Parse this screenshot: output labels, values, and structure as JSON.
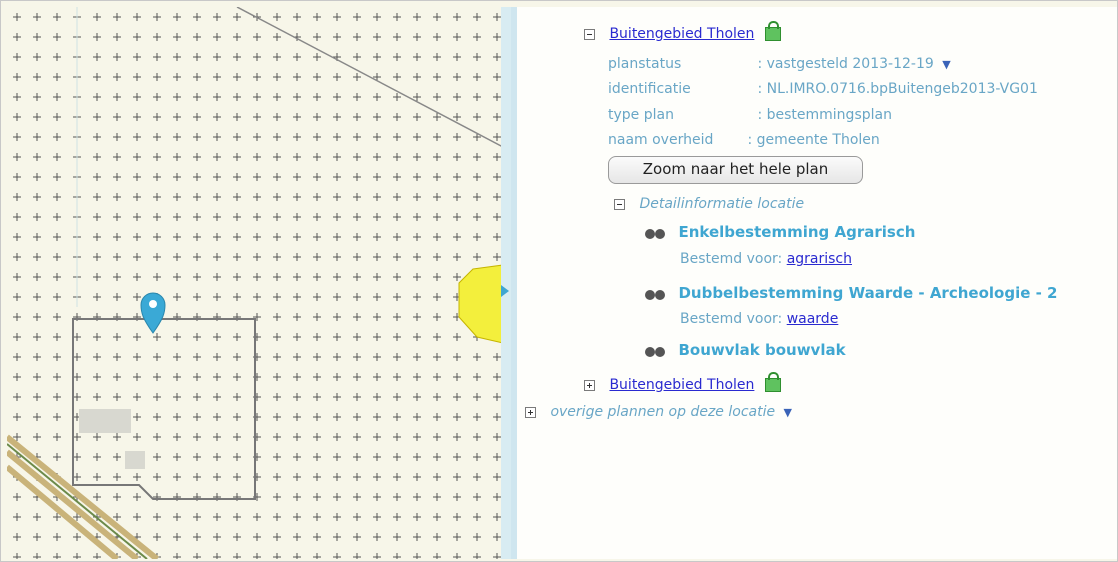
{
  "plan": {
    "title": "Buitengebied Tholen",
    "fields": [
      {
        "label": "planstatus",
        "value": ": vastgesteld 2013-12-19"
      },
      {
        "label": "identificatie",
        "value": ": NL.IMRO.0716.bpBuitengeb2013-VG01"
      },
      {
        "label": "type plan",
        "value": ": bestemmingsplan"
      },
      {
        "label": "naam overheid",
        "value": ": gemeente Tholen"
      }
    ],
    "zoom_button": "Zoom naar het hele plan",
    "detail_header": "Detailinformatie locatie",
    "bestemmingen": [
      {
        "name": "Enkelbestemming Agrarisch",
        "prefix": "Bestemd voor:",
        "link": "agrarisch"
      },
      {
        "name": "Dubbelbestemming Waarde - Archeologie - 2",
        "prefix": "Bestemd voor:",
        "link": "waarde"
      },
      {
        "name": "Bouwvlak bouwvlak"
      }
    ]
  },
  "plan2": {
    "title": "Buitengebied Tholen"
  },
  "overige": {
    "label": "overige plannen op deze locatie"
  },
  "colors": {
    "accent": "#3fa6d1",
    "link": "#2a2ad0",
    "muted": "#69a6c6",
    "marker": "#3aa9d6",
    "polygon": "#f3ef3c"
  },
  "icons": {
    "lock": "lock-icon",
    "binoculars": "binoculars-icon",
    "info": "info-icon",
    "marker": "map-marker-icon"
  }
}
